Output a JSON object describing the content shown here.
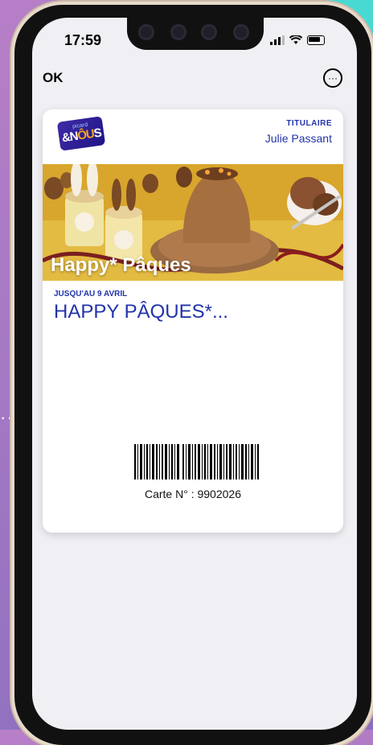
{
  "status": {
    "time": "17:59"
  },
  "nav": {
    "ok_label": "OK",
    "more_icon": "ellipsis-circle-icon"
  },
  "card": {
    "brand_logo_top": "picard",
    "brand_logo_main_a": "&N",
    "brand_logo_main_b": "ÔU",
    "brand_logo_main_c": "S",
    "holder_label": "TITULAIRE",
    "holder_name": "Julie Passant",
    "banner_text": "Happy* Pâques",
    "deadline": "JUSQU'AU 9 AVRIL",
    "offer_title": "HAPPY PÂQUES*...",
    "card_number": "Carte N° : 9902026"
  },
  "colors": {
    "accent": "#2233aa",
    "background": "#efeff4"
  }
}
